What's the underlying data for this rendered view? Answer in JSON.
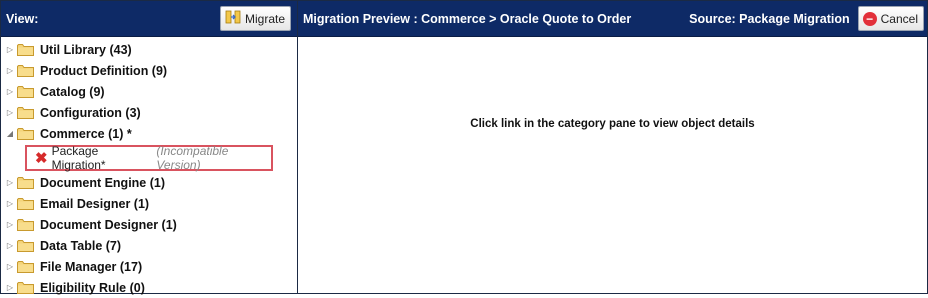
{
  "left_header": {
    "title": "View:",
    "migrate_label": "Migrate"
  },
  "right_header": {
    "title": "Migration Preview : Commerce > Oracle Quote to Order",
    "source": "Source: Package Migration",
    "cancel_label": "Cancel"
  },
  "tree": {
    "items": [
      {
        "label": "Util Library (43)",
        "expanded": false
      },
      {
        "label": "Product Definition (9)",
        "expanded": false
      },
      {
        "label": "Catalog (9)",
        "expanded": false
      },
      {
        "label": "Configuration (3)",
        "expanded": false
      },
      {
        "label": "Commerce (1) *",
        "expanded": true
      },
      {
        "label": "Document Engine (1)",
        "expanded": false
      },
      {
        "label": "Email Designer (1)",
        "expanded": false
      },
      {
        "label": "Document Designer (1)",
        "expanded": false
      },
      {
        "label": "Data Table (7)",
        "expanded": false
      },
      {
        "label": "File Manager (17)",
        "expanded": false
      },
      {
        "label": "Eligibility Rule (0)",
        "expanded": false
      }
    ],
    "child": {
      "name": "Package Migration*",
      "note": "(Incompatible Version)"
    }
  },
  "main": {
    "message": "Click link in the category pane to view object details"
  },
  "colors": {
    "header": "#0e2a66",
    "highlight_border": "#d9535f",
    "error_icon": "#d62b2b"
  },
  "icons": [
    "folder-icon",
    "expand-arrow-icon",
    "collapse-arrow-icon",
    "migrate-icon",
    "error-x-icon",
    "cancel-icon"
  ]
}
